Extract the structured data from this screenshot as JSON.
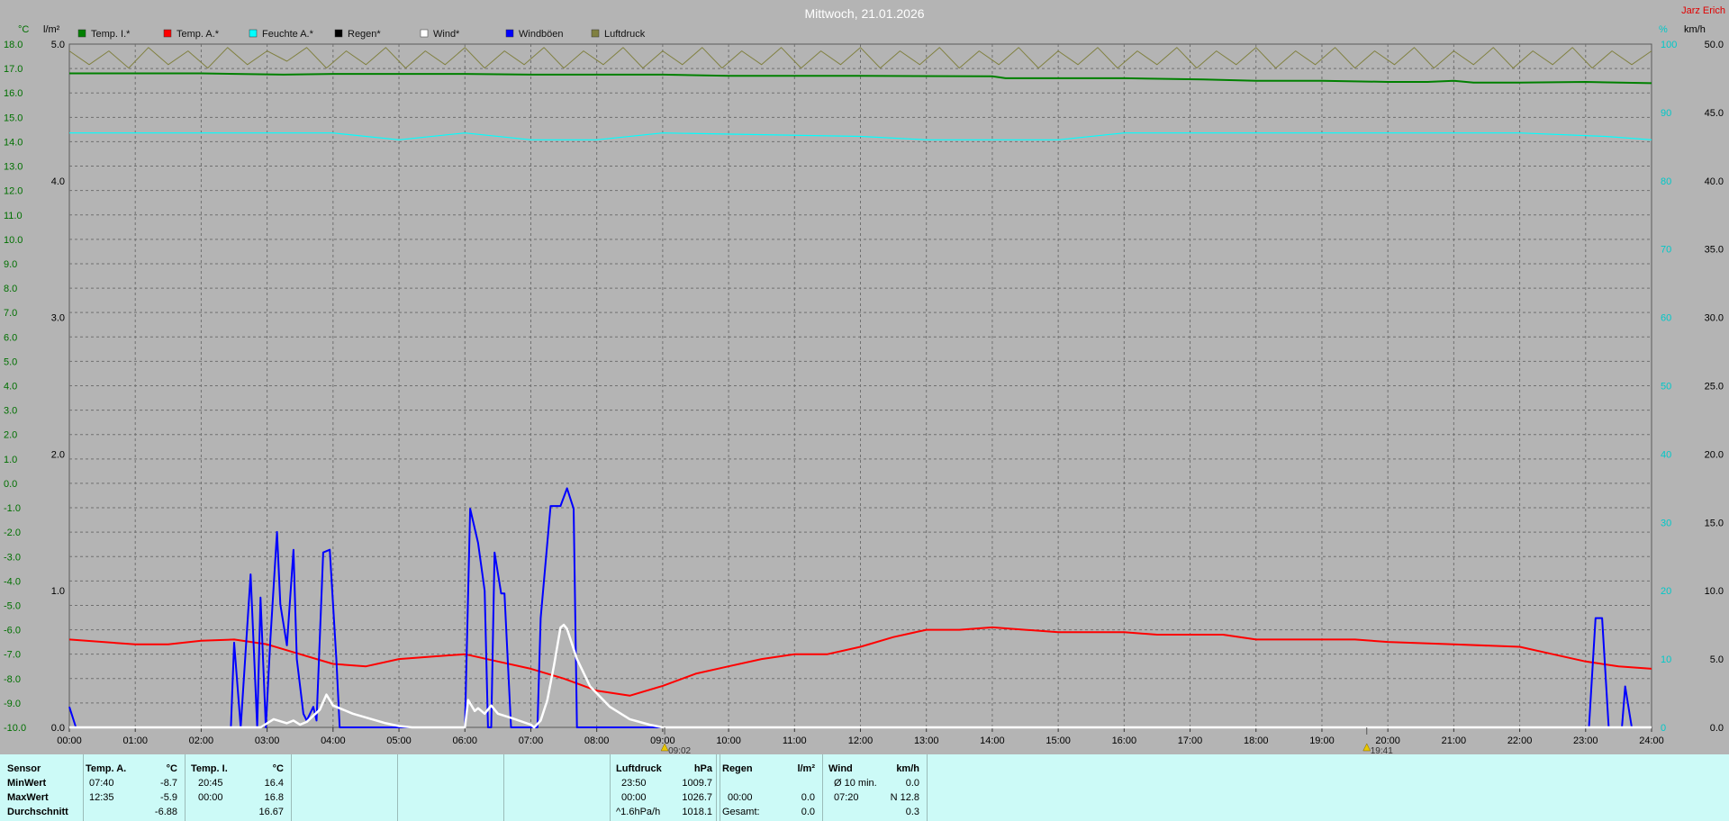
{
  "header": {
    "title": "Mittwoch, 21.01.2026",
    "author": "Jarz Erich"
  },
  "chart_data": {
    "type": "line",
    "x_ticks": [
      "00:00",
      "01:00",
      "02:00",
      "03:00",
      "04:00",
      "05:00",
      "06:00",
      "07:00",
      "08:00",
      "09:00",
      "10:00",
      "11:00",
      "12:00",
      "13:00",
      "14:00",
      "15:00",
      "16:00",
      "17:00",
      "18:00",
      "19:00",
      "20:00",
      "21:00",
      "22:00",
      "23:00",
      "24:00"
    ],
    "xlim": [
      0,
      24
    ],
    "axes": {
      "temp": {
        "unit": "°C",
        "range": [
          -10,
          18
        ],
        "ticks": [
          "18.0",
          "17.0",
          "16.0",
          "15.0",
          "14.0",
          "13.0",
          "12.0",
          "11.0",
          "10.0",
          "9.0",
          "8.0",
          "7.0",
          "6.0",
          "5.0",
          "4.0",
          "3.0",
          "2.0",
          "1.0",
          "0.0",
          "-1.0",
          "-2.0",
          "-3.0",
          "-4.0",
          "-5.0",
          "-6.0",
          "-7.0",
          "-8.0",
          "-9.0",
          "-10.0"
        ]
      },
      "rain": {
        "unit": "l/m²",
        "range": [
          0,
          5
        ],
        "ticks": [
          "5.0",
          "4.0",
          "3.0",
          "2.0",
          "1.0",
          "0.0"
        ]
      },
      "humidity": {
        "unit": "%",
        "range": [
          0,
          100
        ],
        "ticks": [
          "100",
          "90",
          "80",
          "70",
          "60",
          "50",
          "40",
          "30",
          "20",
          "10",
          "0"
        ]
      },
      "wind": {
        "unit": "km/h",
        "range": [
          0,
          50
        ],
        "ticks": [
          "50.0",
          "45.0",
          "40.0",
          "35.0",
          "30.0",
          "25.0",
          "20.0",
          "15.0",
          "10.0",
          "5.0",
          "0.0"
        ]
      }
    },
    "legend": [
      {
        "name": "Temp. I.*",
        "color": "#008000"
      },
      {
        "name": "Temp. A.*",
        "color": "#ff0000"
      },
      {
        "name": "Feuchte A.*",
        "color": "#00ffff"
      },
      {
        "name": "Regen*",
        "color": "#000000"
      },
      {
        "name": "Wind*",
        "color": "#ffffff"
      },
      {
        "name": "Windböen",
        "color": "#0000ff"
      },
      {
        "name": "Luftdruck",
        "color": "#808040"
      }
    ],
    "series": [
      {
        "name": "Temp. I.*",
        "axis": "temp",
        "color": "#008000",
        "points": [
          [
            0,
            16.8
          ],
          [
            2,
            16.8
          ],
          [
            3.25,
            16.75
          ],
          [
            4,
            16.78
          ],
          [
            6,
            16.78
          ],
          [
            7,
            16.75
          ],
          [
            9,
            16.75
          ],
          [
            10,
            16.7
          ],
          [
            12,
            16.7
          ],
          [
            14,
            16.68
          ],
          [
            14.2,
            16.6
          ],
          [
            16,
            16.6
          ],
          [
            17.2,
            16.55
          ],
          [
            18,
            16.5
          ],
          [
            19,
            16.5
          ],
          [
            19.4,
            16.48
          ],
          [
            20,
            16.45
          ],
          [
            20.6,
            16.45
          ],
          [
            21,
            16.5
          ],
          [
            21.3,
            16.42
          ],
          [
            22,
            16.42
          ],
          [
            23,
            16.45
          ],
          [
            24,
            16.4
          ]
        ]
      },
      {
        "name": "Temp. A.*",
        "axis": "temp",
        "color": "#ff0000",
        "points": [
          [
            0,
            -6.4
          ],
          [
            1,
            -6.6
          ],
          [
            1.5,
            -6.6
          ],
          [
            2,
            -6.45
          ],
          [
            2.5,
            -6.4
          ],
          [
            3,
            -6.6
          ],
          [
            3.5,
            -7.0
          ],
          [
            4,
            -7.4
          ],
          [
            4.5,
            -7.5
          ],
          [
            5,
            -7.2
          ],
          [
            5.5,
            -7.1
          ],
          [
            6,
            -7.0
          ],
          [
            6.5,
            -7.3
          ],
          [
            7,
            -7.6
          ],
          [
            7.5,
            -8.0
          ],
          [
            8,
            -8.5
          ],
          [
            8.5,
            -8.7
          ],
          [
            9,
            -8.3
          ],
          [
            9.5,
            -7.8
          ],
          [
            10,
            -7.5
          ],
          [
            10.5,
            -7.2
          ],
          [
            11,
            -7.0
          ],
          [
            11.5,
            -7.0
          ],
          [
            12,
            -6.7
          ],
          [
            12.5,
            -6.3
          ],
          [
            13,
            -6.0
          ],
          [
            13.5,
            -6.0
          ],
          [
            14,
            -5.9
          ],
          [
            14.5,
            -6.0
          ],
          [
            15,
            -6.1
          ],
          [
            15.5,
            -6.1
          ],
          [
            16,
            -6.1
          ],
          [
            16.5,
            -6.2
          ],
          [
            17,
            -6.2
          ],
          [
            17.5,
            -6.2
          ],
          [
            18,
            -6.4
          ],
          [
            19,
            -6.4
          ],
          [
            19.5,
            -6.4
          ],
          [
            20,
            -6.5
          ],
          [
            21,
            -6.6
          ],
          [
            22,
            -6.7
          ],
          [
            22.5,
            -7.0
          ],
          [
            23,
            -7.3
          ],
          [
            23.5,
            -7.5
          ],
          [
            24,
            -7.6
          ]
        ]
      },
      {
        "name": "Feuchte A.*",
        "axis": "humidity",
        "color": "#00ffff",
        "points": [
          [
            0,
            87
          ],
          [
            2,
            87
          ],
          [
            4,
            87
          ],
          [
            5,
            86
          ],
          [
            6,
            87
          ],
          [
            7,
            86
          ],
          [
            8,
            86
          ],
          [
            9,
            87
          ],
          [
            12,
            86.5
          ],
          [
            13,
            86
          ],
          [
            15,
            86
          ],
          [
            16,
            87
          ],
          [
            18,
            87
          ],
          [
            20,
            87
          ],
          [
            22,
            87
          ],
          [
            23.3,
            86.5
          ],
          [
            24,
            86
          ]
        ]
      },
      {
        "name": "Wind*",
        "axis": "wind",
        "color": "#ffffff",
        "points": [
          [
            0,
            0
          ],
          [
            2.9,
            0
          ],
          [
            3.1,
            0.6
          ],
          [
            3.3,
            0.3
          ],
          [
            3.4,
            0.5
          ],
          [
            3.5,
            0.2
          ],
          [
            3.6,
            0.4
          ],
          [
            3.8,
            1.3
          ],
          [
            3.9,
            2.4
          ],
          [
            4,
            1.6
          ],
          [
            4.3,
            1.0
          ],
          [
            4.8,
            0.3
          ],
          [
            5,
            0.1
          ],
          [
            5.2,
            0
          ],
          [
            6,
            0
          ],
          [
            6.05,
            2.0
          ],
          [
            6.15,
            1.2
          ],
          [
            6.2,
            1.4
          ],
          [
            6.3,
            1.0
          ],
          [
            6.4,
            1.6
          ],
          [
            6.5,
            1.0
          ],
          [
            6.7,
            0.7
          ],
          [
            7,
            0.2
          ],
          [
            7.05,
            0
          ],
          [
            7.15,
            0.5
          ],
          [
            7.25,
            2.0
          ],
          [
            7.35,
            4.5
          ],
          [
            7.45,
            7.3
          ],
          [
            7.5,
            7.5
          ],
          [
            7.55,
            7.2
          ],
          [
            7.7,
            5.0
          ],
          [
            7.9,
            3.0
          ],
          [
            8.2,
            1.5
          ],
          [
            8.5,
            0.6
          ],
          [
            8.8,
            0.2
          ],
          [
            9,
            0
          ],
          [
            24,
            0
          ]
        ]
      },
      {
        "name": "Windböen",
        "axis": "wind",
        "color": "#0000ff",
        "points": [
          [
            0,
            1.5
          ],
          [
            0.1,
            0
          ],
          [
            2.45,
            0
          ],
          [
            2.5,
            6.2
          ],
          [
            2.6,
            0
          ],
          [
            2.75,
            11.2
          ],
          [
            2.85,
            0
          ],
          [
            2.9,
            9.5
          ],
          [
            2.98,
            0
          ],
          [
            3.05,
            6.5
          ],
          [
            3.15,
            14.3
          ],
          [
            3.2,
            9.0
          ],
          [
            3.3,
            6.0
          ],
          [
            3.4,
            13.0
          ],
          [
            3.45,
            5.0
          ],
          [
            3.55,
            1.0
          ],
          [
            3.6,
            0.5
          ],
          [
            3.7,
            1.5
          ],
          [
            3.75,
            0.5
          ],
          [
            3.85,
            12.8
          ],
          [
            3.95,
            13.0
          ],
          [
            4.05,
            5.0
          ],
          [
            4.1,
            0
          ],
          [
            6.0,
            0
          ],
          [
            6.08,
            16.0
          ],
          [
            6.2,
            13.5
          ],
          [
            6.3,
            10.0
          ],
          [
            6.35,
            0
          ],
          [
            6.4,
            0
          ],
          [
            6.45,
            12.8
          ],
          [
            6.55,
            9.8
          ],
          [
            6.6,
            9.8
          ],
          [
            6.7,
            0
          ],
          [
            7.1,
            0
          ],
          [
            7.15,
            8.0
          ],
          [
            7.3,
            16.2
          ],
          [
            7.45,
            16.2
          ],
          [
            7.55,
            17.5
          ],
          [
            7.65,
            16.0
          ],
          [
            7.7,
            0
          ],
          [
            23.05,
            0
          ],
          [
            23.15,
            8.0
          ],
          [
            23.25,
            8.0
          ],
          [
            23.35,
            0
          ],
          [
            23.55,
            0
          ],
          [
            23.6,
            3.0
          ],
          [
            23.7,
            0
          ]
        ]
      },
      {
        "name": "Luftdruck",
        "axis": "humidity",
        "color": "#808040",
        "points": [
          [
            0,
            99
          ],
          [
            0.3,
            97
          ],
          [
            0.6,
            99
          ],
          [
            0.9,
            96.5
          ],
          [
            1.2,
            99.5
          ],
          [
            1.5,
            97
          ],
          [
            1.8,
            99
          ],
          [
            2.1,
            96.5
          ],
          [
            2.4,
            99.5
          ],
          [
            2.7,
            97
          ],
          [
            3,
            99
          ],
          [
            3.3,
            97.5
          ],
          [
            3.6,
            99.5
          ],
          [
            3.9,
            96.5
          ],
          [
            4.2,
            99
          ],
          [
            4.5,
            97
          ],
          [
            4.8,
            99.5
          ],
          [
            5.1,
            96.5
          ],
          [
            5.4,
            99
          ],
          [
            5.7,
            97
          ],
          [
            6,
            99.5
          ],
          [
            6.3,
            96.5
          ],
          [
            6.6,
            99
          ],
          [
            6.9,
            97
          ],
          [
            7.2,
            99.5
          ],
          [
            7.5,
            96.5
          ],
          [
            7.8,
            99
          ],
          [
            8.1,
            97
          ],
          [
            8.4,
            99.5
          ],
          [
            8.7,
            96.5
          ],
          [
            9,
            99
          ],
          [
            9.3,
            97
          ],
          [
            9.6,
            99.5
          ],
          [
            9.9,
            96.5
          ],
          [
            10.2,
            99
          ],
          [
            10.5,
            97
          ],
          [
            10.8,
            99.5
          ],
          [
            11.1,
            96.5
          ],
          [
            11.4,
            99
          ],
          [
            11.7,
            97
          ],
          [
            12,
            99.5
          ],
          [
            12.3,
            96.5
          ],
          [
            12.6,
            99
          ],
          [
            12.9,
            97
          ],
          [
            13.2,
            99.5
          ],
          [
            13.5,
            96.5
          ],
          [
            13.8,
            99
          ],
          [
            14.1,
            97
          ],
          [
            14.4,
            99.5
          ],
          [
            14.7,
            96.5
          ],
          [
            15,
            99
          ],
          [
            15.3,
            97
          ],
          [
            15.6,
            99.5
          ],
          [
            15.9,
            96.5
          ],
          [
            16.2,
            99
          ],
          [
            16.5,
            97
          ],
          [
            16.8,
            99.5
          ],
          [
            17.1,
            96.5
          ],
          [
            17.4,
            99
          ],
          [
            17.7,
            97
          ],
          [
            18,
            99.5
          ],
          [
            18.3,
            96.5
          ],
          [
            18.6,
            99
          ],
          [
            18.9,
            97
          ],
          [
            19.2,
            99.5
          ],
          [
            19.5,
            96.5
          ],
          [
            19.8,
            99
          ],
          [
            20.1,
            97
          ],
          [
            20.4,
            99.5
          ],
          [
            20.7,
            96.5
          ],
          [
            21,
            99
          ],
          [
            21.3,
            97
          ],
          [
            21.6,
            99.5
          ],
          [
            21.9,
            96.5
          ],
          [
            22.2,
            99
          ],
          [
            22.5,
            97
          ],
          [
            22.8,
            99.5
          ],
          [
            23.1,
            96.5
          ],
          [
            23.4,
            99
          ],
          [
            23.7,
            97
          ],
          [
            24,
            99
          ]
        ]
      }
    ],
    "markers": [
      {
        "x": 9.03,
        "label": "09:02"
      },
      {
        "x": 19.68,
        "label": "19:41"
      }
    ]
  },
  "table": {
    "col_sensor": {
      "header": "Sensor",
      "rows": [
        "MinWert",
        "MaxWert",
        "Durchschnitt"
      ]
    },
    "col_temp_a": {
      "header": "Temp. A.",
      "unit": "°C",
      "times": [
        "07:40",
        "12:35",
        ""
      ],
      "values": [
        "-8.7",
        "-5.9",
        "-6.88"
      ]
    },
    "col_temp_i": {
      "header": "Temp. I.",
      "unit": "°C",
      "times": [
        "20:45",
        "00:00",
        ""
      ],
      "values": [
        "16.4",
        "16.8",
        "16.67"
      ]
    },
    "col_pressure": {
      "header": "Luftdruck",
      "unit": "hPa",
      "times": [
        "23:50",
        "00:00",
        "^1.6hPa/h"
      ],
      "values": [
        "1009.7",
        "1026.7",
        "1018.1"
      ]
    },
    "col_rain": {
      "header": "Regen",
      "unit": "l/m²",
      "times": [
        "",
        "00:00",
        "Gesamt:"
      ],
      "values": [
        "",
        "0.0",
        "0.0"
      ]
    },
    "col_wind": {
      "header": "Wind",
      "unit": "km/h",
      "times": [
        "Ø 10 min.",
        "07:20",
        ""
      ],
      "values": [
        "0.0",
        "N 12.8",
        "0.3"
      ]
    }
  }
}
